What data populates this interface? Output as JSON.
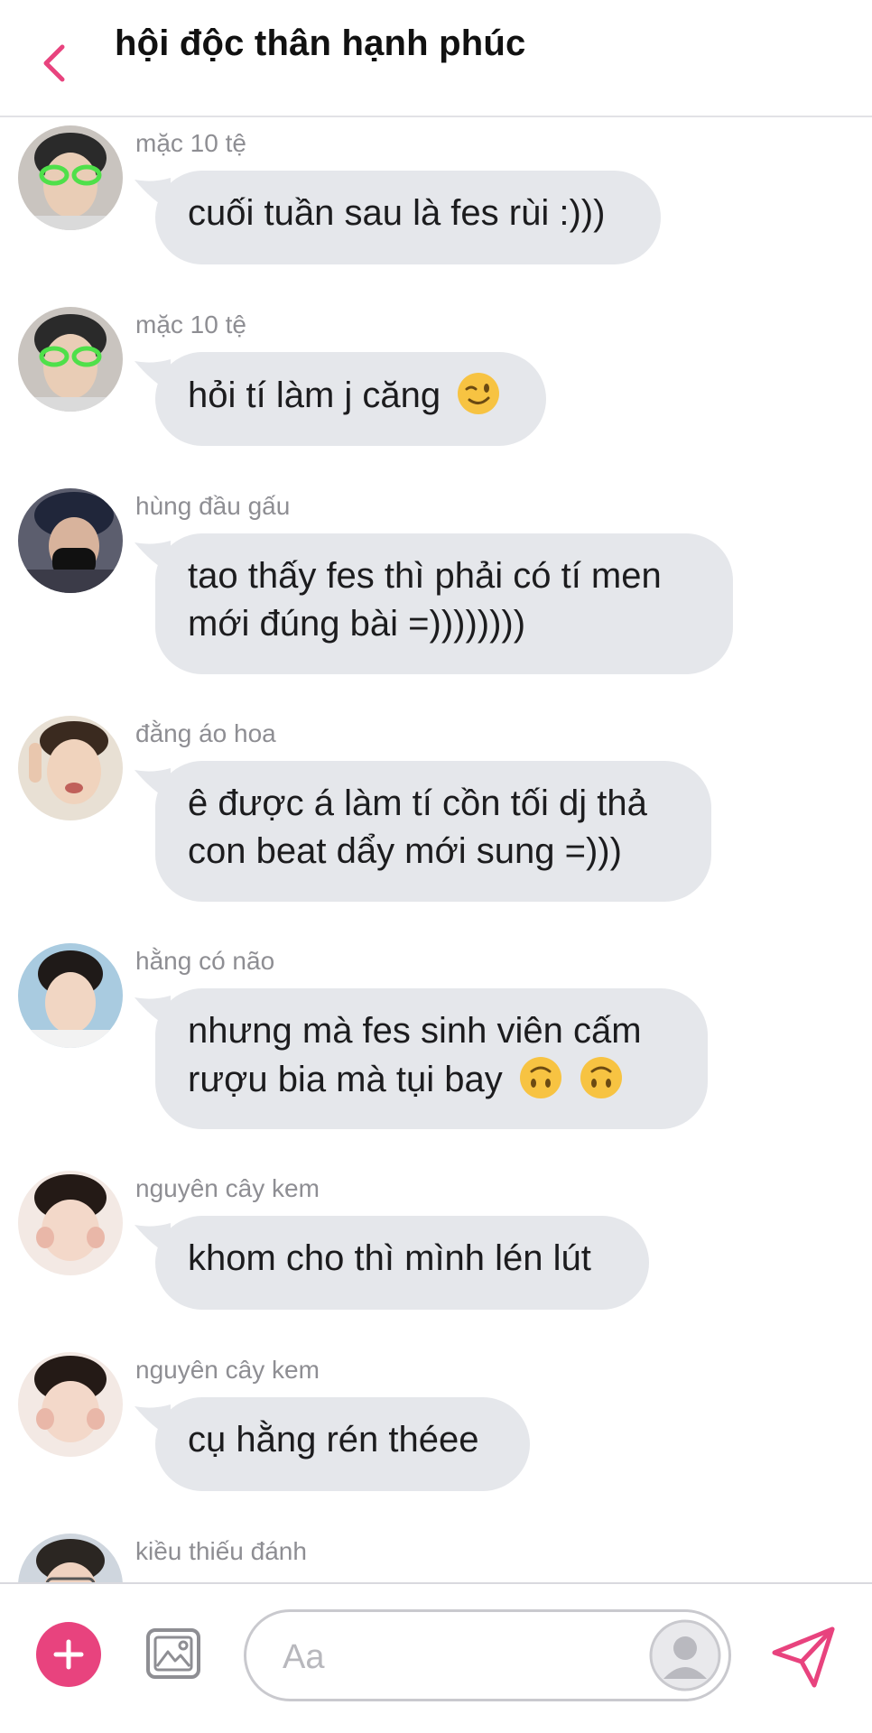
{
  "header": {
    "title": "hội độc thân hạnh phúc"
  },
  "colors": {
    "accent": "#e8437e",
    "bubble": "#e5e7eb",
    "sender": "#8e8e93"
  },
  "messages": [
    {
      "sender": "mặc 10 tệ",
      "lines": [
        "cuối tuần sau là fes rùi :)))"
      ]
    },
    {
      "sender": "mặc 10 tệ",
      "lines": [
        "hỏi tí làm j căng"
      ],
      "emojis": [
        "winking-face"
      ]
    },
    {
      "sender": "hùng đầu gấu",
      "lines": [
        "tao thấy fes thì phải có tí men",
        "mới đúng bài =))))))))"
      ]
    },
    {
      "sender": "đằng áo hoa",
      "lines": [
        "ê được á làm tí cồn tối dj thả",
        "con beat dẩy mới sung =)))"
      ]
    },
    {
      "sender": "hằng có não",
      "lines": [
        "nhưng mà fes sinh viên cấm",
        "rượu bia mà tụi bay"
      ],
      "emojis": [
        "upside-down-face",
        "upside-down-face"
      ]
    },
    {
      "sender": "nguyên cây kem",
      "lines": [
        "khom cho thì mình lén lút"
      ]
    },
    {
      "sender": "nguyên cây kem",
      "lines": [
        "cụ hằng rén théee"
      ]
    },
    {
      "sender": "kiều thiếu đánh",
      "lines": []
    }
  ],
  "composer": {
    "placeholder": "Aa"
  },
  "icons": {
    "back": "chevron-left-icon",
    "add": "plus-icon",
    "image": "image-icon",
    "send": "send-icon",
    "profile": "person-icon"
  }
}
